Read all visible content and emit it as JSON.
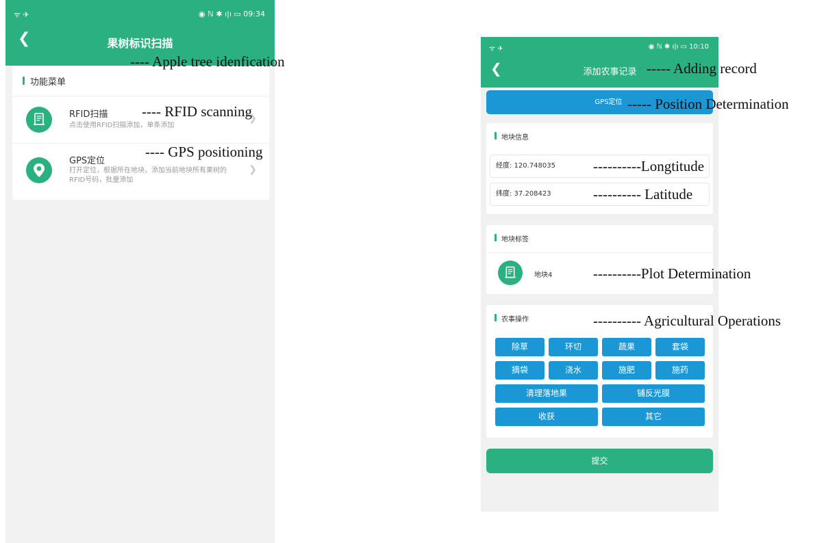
{
  "left_screen": {
    "status_bar": {
      "left": "ᯤ ✈",
      "right": "◉ ℕ ✱ ı|ı ▭ 09:34"
    },
    "title": "果树标识扫描",
    "menu_card": {
      "header": "功能菜单",
      "items": [
        {
          "title": "RFID扫描",
          "desc": "点击使用RFID扫描添加，单条添加",
          "icon": "rfid-receipt-icon"
        },
        {
          "title": "GPS定位",
          "desc": "打开定位，根据所在地块，添加当前地块所有果树的RFID号码，批量添加",
          "icon": "location-pin-icon"
        }
      ]
    }
  },
  "right_screen": {
    "status_bar": {
      "left": "ᯤ ✈",
      "right": "◉ ℕ ✱ ı|ı ▭ 10:10"
    },
    "title": "添加农事记录",
    "gps_button": "GPS定位",
    "plot_info": {
      "header": "地块信息",
      "longitude": "经度: 120.748035",
      "latitude": "纬度: 37.208423"
    },
    "plot_tag": {
      "header": "地块标签",
      "plot_name": "地块4"
    },
    "operations": {
      "header": "农事操作",
      "buttons": [
        "除草",
        "环切",
        "蔬果",
        "套袋",
        "摘袋",
        "浇水",
        "施肥",
        "施药",
        "清理落地果",
        "铺反光膜",
        "收获",
        "其它"
      ]
    },
    "submit": "提交"
  },
  "annotations": {
    "apple_tree": "---- Apple tree idenfication",
    "rfid": "---- RFID scanning",
    "gps": "---- GPS positioning",
    "adding_record": "----- Adding record",
    "position": "----- Position Determination",
    "longitude": "----------Longtitude",
    "latitude": "---------- Latitude",
    "plot": "----------Plot Determination",
    "agricultural": "---------- Agricultural Operations"
  },
  "colors": {
    "green": "#2bb07f",
    "blue": "#1a97d4",
    "background": "#f2f2f2"
  }
}
